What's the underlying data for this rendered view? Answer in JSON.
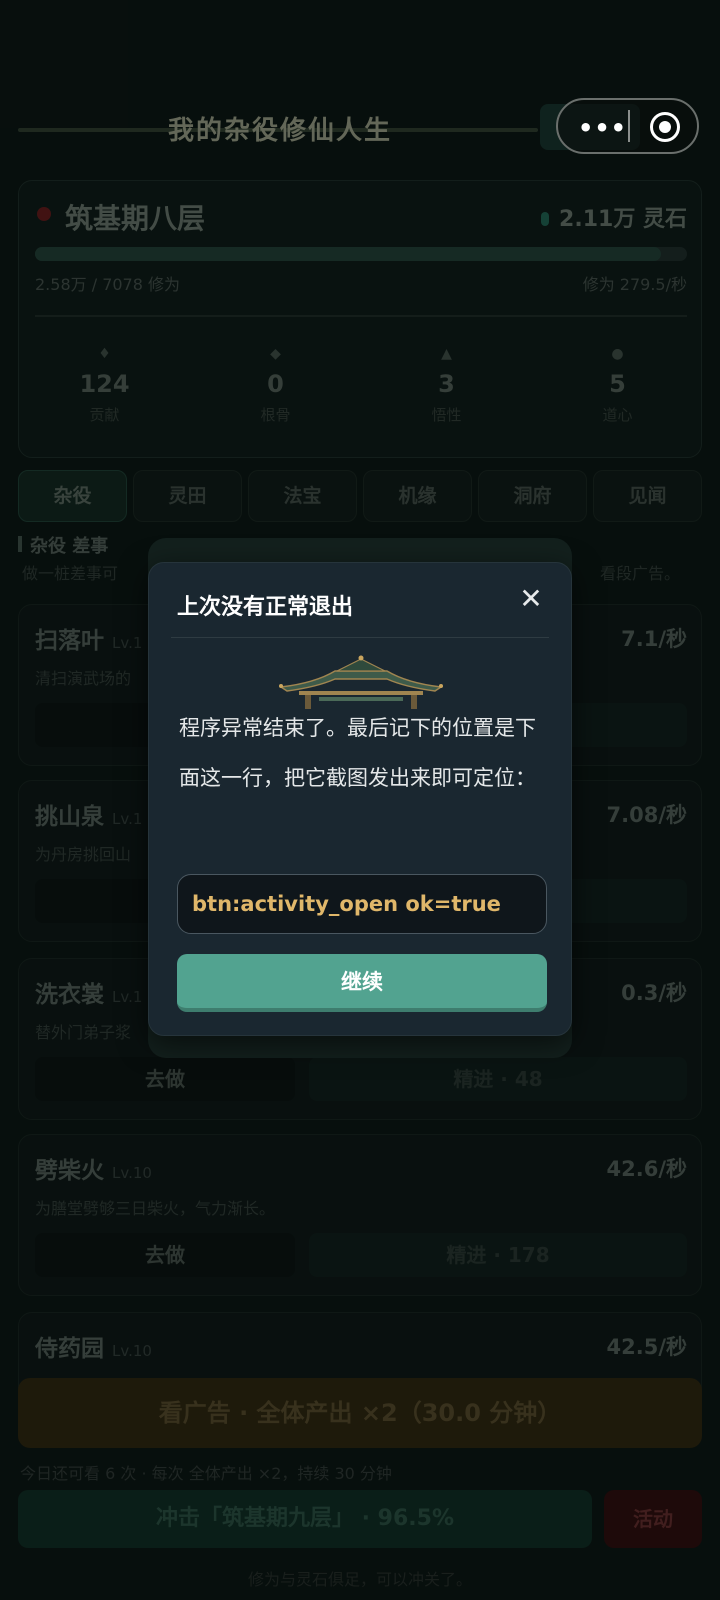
{
  "header": {
    "title": "我的杂役修仙人生"
  },
  "status": {
    "realm": "筑基期八层",
    "spirit_stone": "2.11万 灵石",
    "progress": 0.96,
    "cultivation": "2.58万 / 7078 修为",
    "rate": "修为 279.5/秒",
    "stats": [
      {
        "value": "124",
        "label": "贡献"
      },
      {
        "value": "0",
        "label": "根骨"
      },
      {
        "value": "3",
        "label": "悟性"
      },
      {
        "value": "5",
        "label": "道心"
      }
    ]
  },
  "tabs": [
    {
      "label": "杂役",
      "icon": "broom-icon"
    },
    {
      "label": "灵田",
      "icon": "field-icon"
    },
    {
      "label": "法宝",
      "icon": "treasure-icon"
    },
    {
      "label": "机缘",
      "icon": "fortune-icon"
    },
    {
      "label": "洞府",
      "icon": "cave-icon"
    },
    {
      "label": "见闻",
      "icon": "lore-icon"
    }
  ],
  "section": {
    "title": "杂役 差事",
    "desc_left": "做一桩差事可",
    "desc_right": "看段广告。"
  },
  "jobs": [
    {
      "name": "扫落叶",
      "level": "Lv.1",
      "rate": "7.1/秒",
      "desc": "清扫演武场的",
      "go": "",
      "upgrade": ""
    },
    {
      "name": "挑山泉",
      "level": "Lv.1",
      "rate": "7.08/秒",
      "desc": "为丹房挑回山",
      "go": "",
      "upgrade": ""
    },
    {
      "name": "洗衣裳",
      "level": "Lv.1",
      "rate": "0.3/秒",
      "desc": "替外门弟子浆",
      "go": "去做",
      "upgrade": "精进 · 48"
    },
    {
      "name": "劈柴火",
      "level": "Lv.10",
      "rate": "42.6/秒",
      "desc": "为膳堂劈够三日柴火，气力渐长。",
      "go": "去做",
      "upgrade": "精进 · 178"
    },
    {
      "name": "侍药园",
      "level": "Lv.10",
      "rate": "42.5/秒",
      "desc": "",
      "go": "",
      "upgrade": ""
    }
  ],
  "footer": {
    "ad_button": "看广告 · 全体产出 ×2（30.0 分钟）",
    "ad_note": "今日还可看 6 次 · 每次 全体产出 ×2，持续 30 分钟",
    "breakthrough": "冲击「筑基期九层」 · 96.5%",
    "activity": "活动",
    "note": "修为与灵石俱足，可以冲关了。"
  },
  "modal": {
    "title": "上次没有正常退出",
    "message": "程序异常结束了。最后记下的位置是下面这一行，把它截图发出来即可定位：",
    "code": "btn:activity_open ok=true",
    "continue_label": "继续"
  },
  "colors": {
    "accent": "#52a390",
    "code_text": "#e0b76a",
    "modal_bg": "#1a2730"
  }
}
